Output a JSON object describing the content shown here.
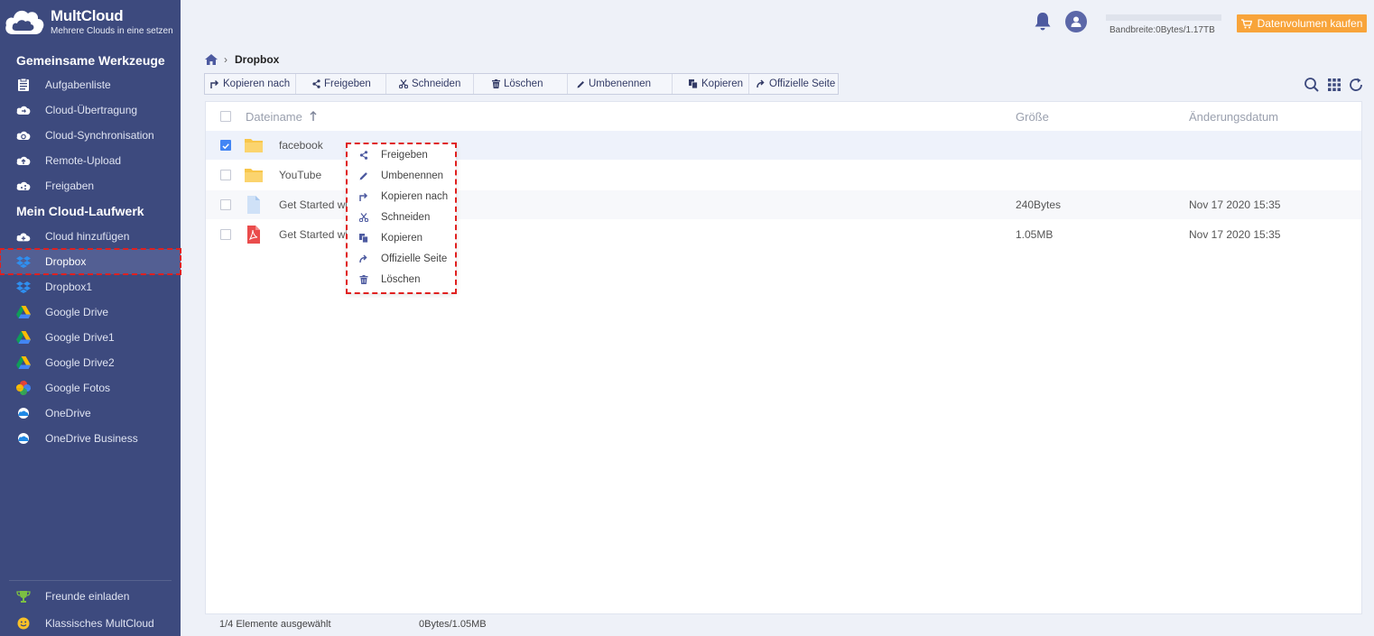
{
  "app": {
    "title": "MultCloud",
    "subtitle": "Mehrere Clouds in eine setzen"
  },
  "sidebar": {
    "section_tools": "Gemeinsame Werkzeuge",
    "tools": [
      {
        "label": "Aufgabenliste",
        "icon": "task-list-icon"
      },
      {
        "label": "Cloud-Übertragung",
        "icon": "cloud-transfer-icon"
      },
      {
        "label": "Cloud-Synchronisation",
        "icon": "cloud-sync-icon"
      },
      {
        "label": "Remote-Upload",
        "icon": "remote-upload-icon"
      },
      {
        "label": "Freigaben",
        "icon": "share-icon"
      }
    ],
    "section_drive": "Mein Cloud-Laufwerk",
    "drives": [
      {
        "label": "Cloud hinzufügen",
        "icon": "add-cloud-icon"
      },
      {
        "label": "Dropbox",
        "icon": "dropbox-icon",
        "active": true
      },
      {
        "label": "Dropbox1",
        "icon": "dropbox-icon"
      },
      {
        "label": "Google Drive",
        "icon": "google-drive-icon"
      },
      {
        "label": "Google Drive1",
        "icon": "google-drive-icon"
      },
      {
        "label": "Google Drive2",
        "icon": "google-drive-icon"
      },
      {
        "label": "Google Fotos",
        "icon": "google-photos-icon"
      },
      {
        "label": "OneDrive",
        "icon": "onedrive-icon"
      },
      {
        "label": "OneDrive Business",
        "icon": "onedrive-icon"
      }
    ],
    "bottom": [
      {
        "label": "Freunde einladen",
        "icon": "trophy-icon"
      },
      {
        "label": "Klassisches MultCloud",
        "icon": "smiley-icon"
      }
    ]
  },
  "topbar": {
    "bandwidth": "Bandbreite:0Bytes/1.17TB",
    "buy_label": "Datenvolumen kaufen"
  },
  "breadcrumb": {
    "current": "Dropbox"
  },
  "toolbar": {
    "copy_to": "Kopieren nach",
    "share": "Freigeben",
    "cut": "Schneiden",
    "delete": "Löschen",
    "rename": "Umbenennen",
    "copy": "Kopieren",
    "official": "Offizielle Seite"
  },
  "table": {
    "col_name": "Dateiname",
    "col_size": "Größe",
    "col_date": "Änderungsdatum",
    "rows": [
      {
        "name": "facebook",
        "type": "folder",
        "size": "",
        "date": "",
        "checked": true
      },
      {
        "name": "YouTube",
        "type": "folder",
        "size": "",
        "date": "",
        "checked": false
      },
      {
        "name": "Get Started wit",
        "type": "file",
        "size": "240Bytes",
        "date": "Nov 17 2020 15:35",
        "checked": false
      },
      {
        "name": "Get Started wit",
        "type": "pdf",
        "size": "1.05MB",
        "date": "Nov 17 2020 15:35",
        "checked": false
      }
    ]
  },
  "context_menu": {
    "items": [
      {
        "label": "Freigeben",
        "icon": "share-icon"
      },
      {
        "label": "Umbenennen",
        "icon": "pencil-icon"
      },
      {
        "label": "Kopieren nach",
        "icon": "copy-to-icon"
      },
      {
        "label": "Schneiden",
        "icon": "scissors-icon"
      },
      {
        "label": "Kopieren",
        "icon": "copy-icon"
      },
      {
        "label": "Offizielle Seite",
        "icon": "external-arrow-icon"
      },
      {
        "label": "Löschen",
        "icon": "trash-icon"
      }
    ]
  },
  "status": {
    "selected": "1/4 Elemente ausgewählt",
    "size": "0Bytes/1.05MB"
  },
  "colors": {
    "sidebar": "#3d4a7e",
    "accent": "#f8a43a",
    "highlight": "#e0201f",
    "toolbar_text": "#333b66"
  }
}
